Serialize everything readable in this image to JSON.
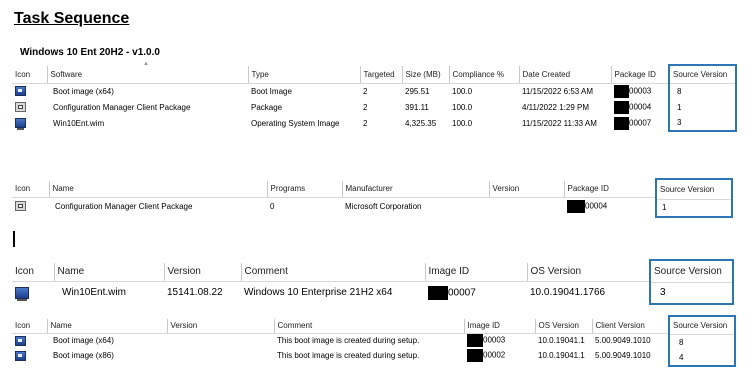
{
  "title": "Task Sequence",
  "subtitle": "Windows 10 Ent 20H2 - v1.0.0",
  "table1": {
    "headers": [
      "Icon",
      "Software",
      "Type",
      "Targeted",
      "Size (MB)",
      "Compliance %",
      "Date Created",
      "Package ID",
      "Source Version"
    ],
    "rows": [
      {
        "icon": "boot-image-icon",
        "software": "Boot image (x64)",
        "type": "Boot Image",
        "targeted": "2",
        "size": "295.51",
        "compliance": "100.0",
        "date": "11/15/2022 6:53 AM",
        "package_id": "00003",
        "source_version": "8"
      },
      {
        "icon": "package-icon",
        "software": "Configuration Manager Client Package",
        "type": "Package",
        "targeted": "2",
        "size": "391.11",
        "compliance": "100.0",
        "date": "4/11/2022 1:29 PM",
        "package_id": "00004",
        "source_version": "1"
      },
      {
        "icon": "os-image-icon",
        "software": "Win10Ent.wim",
        "type": "Operating System Image",
        "targeted": "2",
        "size": "4,325.35",
        "compliance": "100.0",
        "date": "11/15/2022 11:33 AM",
        "package_id": "00007",
        "source_version": "3"
      }
    ]
  },
  "table2": {
    "headers": [
      "Icon",
      "Name",
      "Programs",
      "Manufacturer",
      "Version",
      "Package ID",
      "Source Version"
    ],
    "rows": [
      {
        "icon": "package-icon",
        "name": "Configuration Manager Client Package",
        "programs": "0",
        "manufacturer": "Microsoft Corporation",
        "version": "",
        "package_id": "00004",
        "source_version": "1"
      }
    ]
  },
  "table3": {
    "headers": [
      "Icon",
      "Name",
      "Version",
      "Comment",
      "Image ID",
      "OS Version",
      "Source Version"
    ],
    "rows": [
      {
        "icon": "os-image-icon",
        "name": "Win10Ent.wim",
        "version": "15141.08.22",
        "comment": "Windows 10 Enterprise 21H2  x64",
        "image_id": "00007",
        "os_version": "10.0.19041.1766",
        "source_version": "3"
      }
    ]
  },
  "table4": {
    "headers": [
      "Icon",
      "Name",
      "Version",
      "Comment",
      "Image ID",
      "OS Version",
      "Client Version",
      "Source Version"
    ],
    "rows": [
      {
        "icon": "boot-image-icon",
        "name": "Boot image (x64)",
        "version": "",
        "comment": "This boot image is created during setup.",
        "image_id": "00003",
        "os_version": "10.0.19041.1",
        "client_version": "5.00.9049.1010",
        "source_version": "8"
      },
      {
        "icon": "boot-image-icon",
        "name": "Boot image (x86)",
        "version": "",
        "comment": "This boot image is created during setup.",
        "image_id": "00002",
        "os_version": "10.0.19041.1",
        "client_version": "5.00.9049.1010",
        "source_version": "4"
      }
    ]
  }
}
